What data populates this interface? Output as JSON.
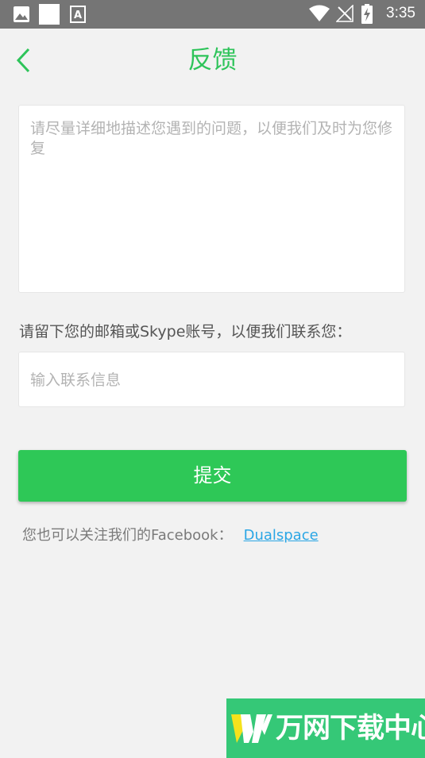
{
  "status_bar": {
    "time": "3:35",
    "left_icons": [
      "image-icon",
      "square-icon",
      "a-box-icon"
    ],
    "right_icons": [
      "wifi-icon",
      "signal-off-icon",
      "battery-charging-icon"
    ]
  },
  "header": {
    "title": "反馈",
    "back_icon": "chevron-left-icon",
    "accent_color": "#2ec45a"
  },
  "feedback": {
    "placeholder": "请尽量详细地描述您遇到的问题，以便我们及时为您修复"
  },
  "contact": {
    "label": "请留下您的邮箱或Skype账号，以便我们联系您：",
    "placeholder": "输入联系信息"
  },
  "submit": {
    "label": "提交",
    "color": "#2ec857"
  },
  "facebook": {
    "prefix": "您也可以关注我们的Facebook：",
    "link_text": "Dualspace",
    "link_color": "#2aa6e5"
  },
  "watermark": {
    "text": "万网下载中心",
    "color": "#35c877"
  }
}
